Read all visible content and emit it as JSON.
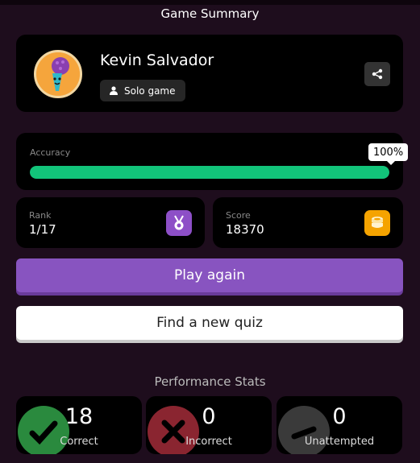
{
  "header": {
    "title": "Game Summary"
  },
  "profile": {
    "name": "Kevin Salvador",
    "mode_label": "Solo game"
  },
  "accuracy": {
    "label": "Accuracy",
    "value_label": "100%",
    "percent": 100
  },
  "rank": {
    "label": "Rank",
    "value": "1/17"
  },
  "score": {
    "label": "Score",
    "value": "18370"
  },
  "actions": {
    "play_again": "Play again",
    "find_quiz": "Find a new quiz"
  },
  "performance": {
    "title": "Performance Stats",
    "correct": {
      "count": "18",
      "label": "Correct"
    },
    "incorrect": {
      "count": "0",
      "label": "Incorrect"
    },
    "unattempted": {
      "count": "0",
      "label": "Unattempted"
    }
  },
  "colors": {
    "background": "#1e0d1d",
    "accent": "#8854c0",
    "accuracy_fill": "#12c47a",
    "correct": "#2a8a3e",
    "incorrect": "#8a2530",
    "unattempted": "#3a3a3a"
  }
}
